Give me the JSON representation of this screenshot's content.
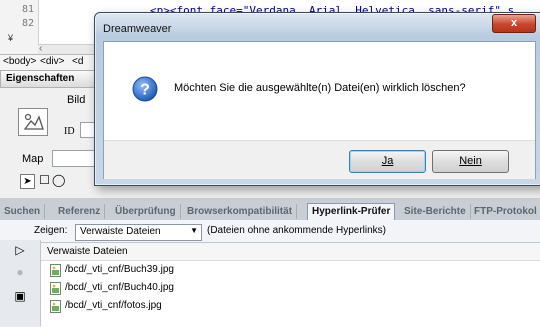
{
  "code": {
    "line_numbers": [
      "81",
      "82"
    ],
    "line_81_text": "<p><font face=\"Verdana, Arial, Helvetica, sans-serif\" s",
    "line_82_text": ""
  },
  "tag_selector": [
    "<body>",
    "<div>",
    "<d"
  ],
  "properties": {
    "title": "Eigenschaften",
    "label_image": "Bild",
    "label_id": "ID",
    "label_map": "Map"
  },
  "results_tabs": [
    "Suchen",
    "Referenz",
    "Überprüfung",
    "Browserkompatibilität",
    "Hyperlink-Prüfer",
    "Site-Berichte",
    "FTP-Protokol"
  ],
  "active_tab": "Hyperlink-Prüfer",
  "link_checker": {
    "show_label": "Zeigen:",
    "show_value": "Verwaiste Dateien",
    "show_hint": "(Dateien ohne ankommende Hyperlinks)",
    "column_header": "Verwaiste Dateien",
    "files": [
      "/bcd/_vti_cnf/Buch39.jpg",
      "/bcd/_vti_cnf/Buch40.jpg",
      "/bcd/_vti_cnf/fotos.jpg"
    ]
  },
  "dialog": {
    "title": "Dreamweaver",
    "message": "Möchten Sie die ausgewählte(n) Datei(en) wirklich löschen?",
    "yes_label": "Ja",
    "no_label": "Nein",
    "close_label": "x"
  },
  "colors": {
    "dialog_title_bg": "#c8d7e8",
    "close_button": "#c8452b",
    "question_icon": "#2f6fc4"
  }
}
